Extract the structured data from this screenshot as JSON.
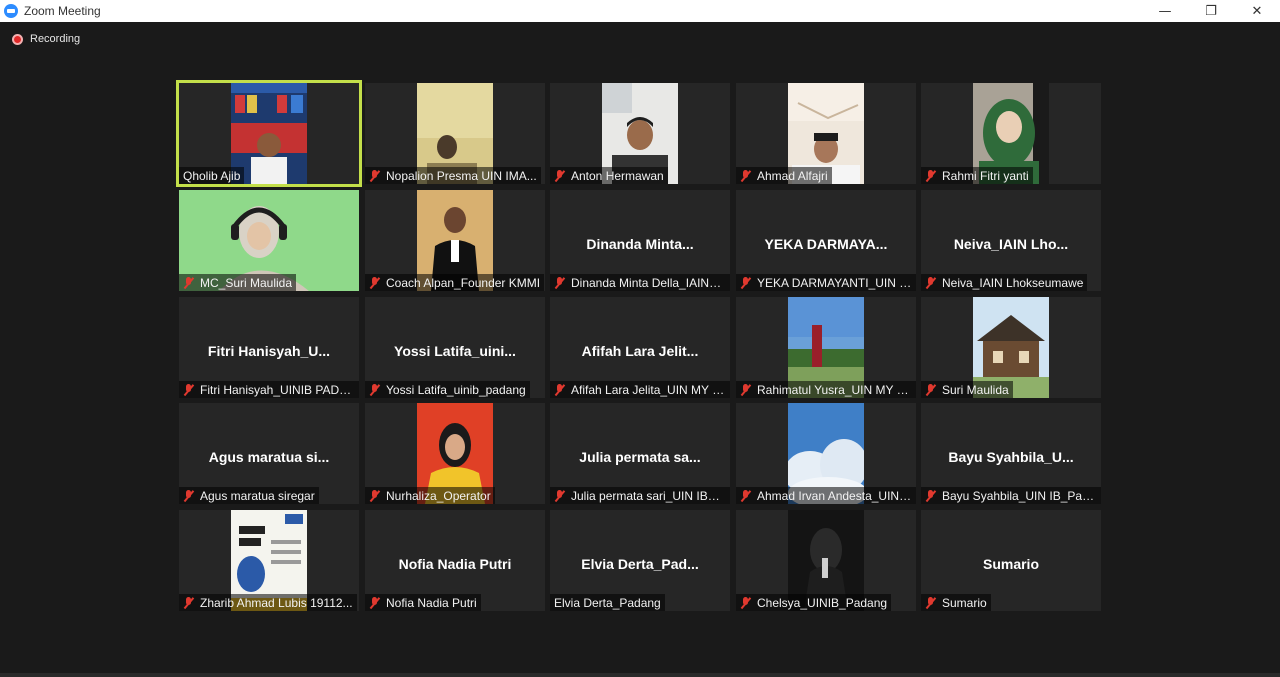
{
  "window": {
    "title": "Zoom Meeting",
    "minimize": "—",
    "restore": "❐",
    "close": "✕"
  },
  "recording": {
    "label": "Recording"
  },
  "tiles": [
    {
      "caption": "Qholib Ajib",
      "display": "",
      "video": "presenter-with-poster",
      "muted": false,
      "active": true
    },
    {
      "caption": "Nopalion Presma UIN IMA...",
      "display": "",
      "video": "dim-face",
      "muted": true
    },
    {
      "caption": "Anton Hermawan",
      "display": "",
      "video": "face-room",
      "muted": true
    },
    {
      "caption": "Ahmad Alfajri",
      "display": "",
      "video": "face-cap",
      "muted": true
    },
    {
      "caption": "Rahmi Fitri yanti",
      "display": "",
      "video": "face-hijab-green",
      "muted": true
    },
    {
      "caption": "MC_Suri Maulida",
      "display": "",
      "video": "green-screen-headphones",
      "muted": true
    },
    {
      "caption": "Coach Alpan_Founder KMMI",
      "display": "",
      "video": "suit-portrait",
      "muted": true
    },
    {
      "caption": "Dinanda Minta Della_IAIN_L...",
      "display": "Dinanda  Minta...",
      "video": "none",
      "muted": true
    },
    {
      "caption": "YEKA DARMAYANTI_UIN IB_...",
      "display": "YEKA  DARMAYA...",
      "video": "none",
      "muted": true
    },
    {
      "caption": "Neiva_IAIN Lhokseumawe",
      "display": "Neiva_IAIN  Lho...",
      "video": "none",
      "muted": true
    },
    {
      "caption": "Fitri Hanisyah_UINIB PADA...",
      "display": "Fitri  Hanisyah_U...",
      "video": "none",
      "muted": true
    },
    {
      "caption": "Yossi Latifa_uinib_padang",
      "display": "Yossi  Latifa_uini...",
      "video": "none",
      "muted": true
    },
    {
      "caption": "Afifah Lara Jelita_UIN MY B...",
      "display": "Afifah  Lara  Jelit...",
      "video": "none",
      "muted": true
    },
    {
      "caption": "Rahimatul Yusra_UIN MY B...",
      "display": "",
      "video": "landscape-photo",
      "muted": true
    },
    {
      "caption": "Suri Maulida",
      "display": "",
      "video": "house-photo",
      "muted": true
    },
    {
      "caption": "Agus maratua siregar",
      "display": "Agus  maratua  si...",
      "video": "none",
      "muted": true
    },
    {
      "caption": "Nurhaliza_Operator",
      "display": "",
      "video": "red-bg-yellow-jacket",
      "muted": true
    },
    {
      "caption": "Julia permata sari_UIN IB_P...",
      "display": "Julia  permata  sa...",
      "video": "none",
      "muted": true
    },
    {
      "caption": "Ahmad Irvan Andesta_UIN I...",
      "display": "",
      "video": "sky-clouds",
      "muted": true
    },
    {
      "caption": "Bayu Syahbila_UIN IB_Pada...",
      "display": "Bayu  Syahbila_U...",
      "video": "none",
      "muted": true
    },
    {
      "caption": "Zharib Ahmad Lubis 19112...",
      "display": "",
      "video": "poster-i-am-ready",
      "muted": true
    },
    {
      "caption": "Nofia Nadia Putri",
      "display": "Nofia Nadia Putri",
      "video": "none",
      "muted": true
    },
    {
      "caption": "Elvia Derta_Padang",
      "display": "Elvia  Derta_Pad...",
      "video": "none",
      "muted": false
    },
    {
      "caption": "Chelsya_UINIB_Padang",
      "display": "",
      "video": "dark-portrait",
      "muted": true
    },
    {
      "caption": "Sumario",
      "display": "Sumario",
      "video": "none",
      "muted": true
    }
  ],
  "colors": {
    "active_speaker_border": "#c3df4a",
    "mute_red": "#e0392f",
    "recording_red": "#e02828",
    "background": "#1a1a1a",
    "tile": "#262626"
  }
}
